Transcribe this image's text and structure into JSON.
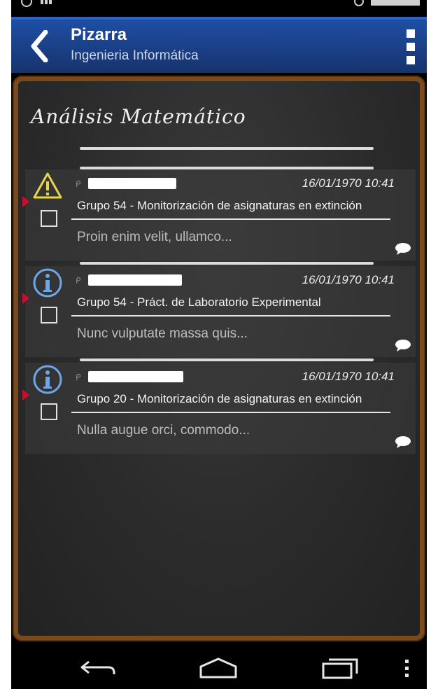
{
  "app": {
    "title": "Pizarra",
    "subtitle": "Ingenieria Informática"
  },
  "board": {
    "heading": "Análisis Matemático"
  },
  "messages": [
    {
      "type": "warning-icon",
      "date": "16/01/1970 10:41",
      "subject": "Grupo 54 - Monitorización de asignaturas en extinción",
      "preview": "Proin enim velit, ullamco..."
    },
    {
      "type": "info-icon",
      "date": "16/01/1970 10:41",
      "subject": "Grupo 54 - Práct. de Laboratorio Experimental",
      "preview": "Nunc vulputate massa quis..."
    },
    {
      "type": "info-icon",
      "date": "16/01/1970 10:41",
      "subject": "Grupo 20 - Monitorización de asignaturas en extinción",
      "preview": "Nulla augue orci, commodo..."
    }
  ],
  "colors": {
    "action_bar": "#1a3f86",
    "board_frame": "#7a4a1e",
    "board": "#2b2b2b",
    "warning": "#e8d64a",
    "info": "#6fa7e6",
    "marker": "#c8102e"
  }
}
